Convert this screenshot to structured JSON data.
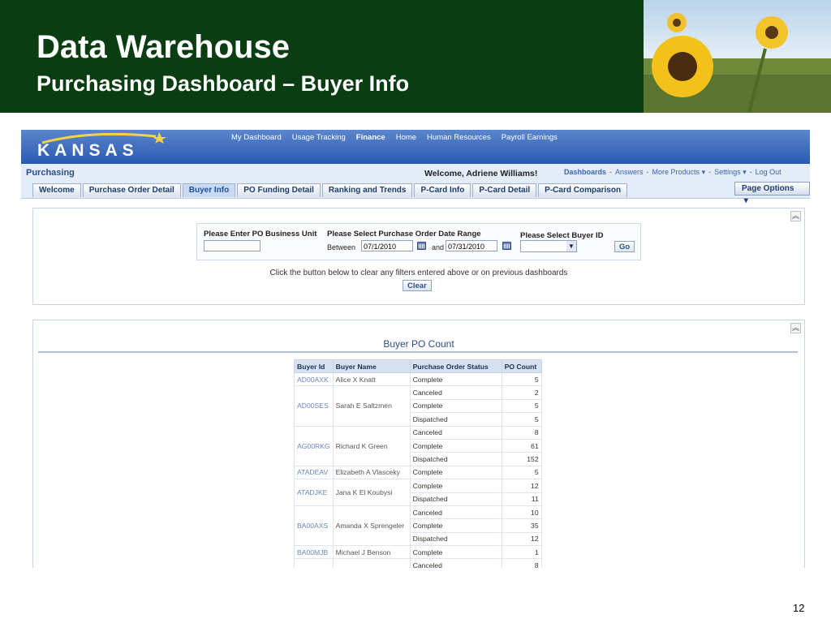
{
  "slide": {
    "title": "Data Warehouse",
    "subtitle": "Purchasing Dashboard – Buyer Info",
    "page_number": "12"
  },
  "app": {
    "logo": "KANSAS",
    "top_nav": [
      "My Dashboard",
      "Usage Tracking",
      "Finance",
      "Home",
      "Human Resources",
      "Payroll Earnings"
    ],
    "active_top_nav": "Finance",
    "section": "Purchasing",
    "welcome": "Welcome, Adriene Williams!",
    "util_links": {
      "dashboards": "Dashboards",
      "answers": "Answers",
      "more_products": "More Products",
      "settings": "Settings",
      "logout": "Log Out"
    },
    "tabs": [
      "Welcome",
      "Purchase Order Detail",
      "Buyer Info",
      "PO Funding Detail",
      "Ranking and Trends",
      "P-Card Info",
      "P-Card Detail",
      "P-Card Comparison"
    ],
    "active_tab": "Buyer Info",
    "page_options": "Page Options"
  },
  "filters": {
    "business_unit_label": "Please Enter PO Business Unit",
    "business_unit_value": "",
    "date_range_label": "Please Select Purchase Order Date Range",
    "between_label": "Between",
    "start_date": "07/1/2010",
    "and_label": "and",
    "end_date": "07/31/2010",
    "buyer_label": "Please Select Buyer ID",
    "buyer_value": "",
    "go_button": "Go",
    "clear_message": "Click the button below to clear any filters entered above or on previous dashboards",
    "clear_button": "Clear"
  },
  "buyer_table": {
    "title": "Buyer PO Count",
    "columns": [
      "Buyer Id",
      "Buyer Name",
      "Purchase Order Status",
      "PO Count"
    ],
    "groups": [
      {
        "id": "AD00AXK",
        "name": "Alice X Knatt",
        "rows": [
          {
            "status": "Complete",
            "count": "5"
          }
        ]
      },
      {
        "id": "AD00SES",
        "name": "Sarah E Saltzmen",
        "rows": [
          {
            "status": "Canceled",
            "count": "2"
          },
          {
            "status": "Complete",
            "count": "5"
          },
          {
            "status": "Dispatched",
            "count": "5"
          }
        ]
      },
      {
        "id": "AG00RKG",
        "name": "Richard K Green",
        "rows": [
          {
            "status": "Canceled",
            "count": "8"
          },
          {
            "status": "Complete",
            "count": "61"
          },
          {
            "status": "Dispatched",
            "count": "152"
          }
        ]
      },
      {
        "id": "ATADEAV",
        "name": "Elizabeth A Vlasceky",
        "rows": [
          {
            "status": "Complete",
            "count": "5"
          }
        ]
      },
      {
        "id": "ATADJKE",
        "name": "Jana K El Koubysi",
        "rows": [
          {
            "status": "Complete",
            "count": "12"
          },
          {
            "status": "Dispatched",
            "count": "11"
          }
        ]
      },
      {
        "id": "BA00AXS",
        "name": "Amanda X Sprengeler",
        "rows": [
          {
            "status": "Canceled",
            "count": "10"
          },
          {
            "status": "Complete",
            "count": "35"
          },
          {
            "status": "Dispatched",
            "count": "12"
          }
        ]
      },
      {
        "id": "BA00MJB",
        "name": "Michael J Benson",
        "rows": [
          {
            "status": "Complete",
            "count": "1"
          }
        ]
      },
      {
        "id": "",
        "name": "",
        "rows": [
          {
            "status": "Canceled",
            "count": "8"
          }
        ]
      }
    ]
  },
  "colors": {
    "slide_header_bg": "#0b3d12",
    "banner_blue": "#2a5ab0",
    "link_blue": "#3a66b0",
    "table_header_bg": "#d6e2f1"
  }
}
